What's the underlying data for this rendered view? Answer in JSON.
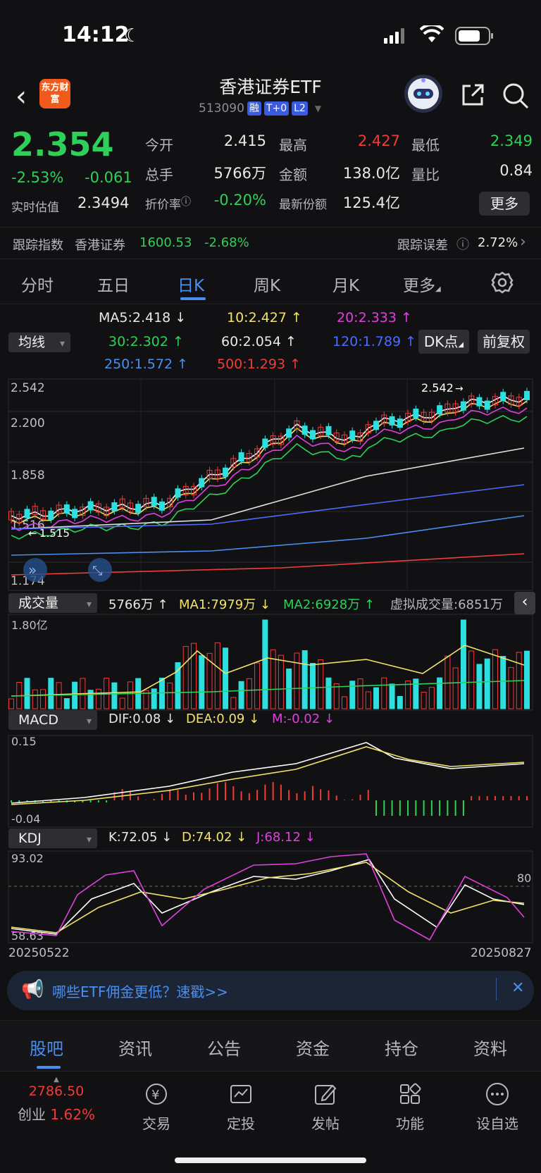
{
  "status": {
    "time": "14:12"
  },
  "header": {
    "back_icon": "chevron-left-icon",
    "logo_text": "东方财富",
    "title": "香港证券ETF",
    "code": "513090",
    "tags": [
      "融",
      "T+0",
      "L2"
    ]
  },
  "quote": {
    "price": "2.354",
    "pct": "-2.53%",
    "change": "-0.061",
    "est_label": "实时估值",
    "est_value": "2.3494",
    "open_label": "今开",
    "open": "2.415",
    "high_label": "最高",
    "high": "2.427",
    "low_label": "最低",
    "low": "2.349",
    "vol_label": "总手",
    "vol": "5766万",
    "amt_label": "金额",
    "amt": "138.0亿",
    "ratio_label": "量比",
    "ratio": "0.84",
    "discount_label": "折价率",
    "discount": "-0.20%",
    "shares_label": "最新份额",
    "shares": "125.4亿",
    "more": "更多"
  },
  "tracking": {
    "label": "跟踪指数",
    "index_name": "香港证券",
    "index_value": "1600.53",
    "index_pct": "-2.68%",
    "error_label": "跟踪误差",
    "error_value": "2.72%"
  },
  "tabs": [
    "分时",
    "五日",
    "日K",
    "周K",
    "月K",
    "更多"
  ],
  "active_tab": "日K",
  "ma": {
    "selector": "均线",
    "ma5": "MA5:2.418 ↓",
    "ma10": "10:2.427 ↑",
    "ma20": "20:2.333 ↑",
    "ma30": "30:2.302 ↑",
    "ma60": "60:2.054 ↑",
    "ma120": "120:1.789 ↑",
    "ma250": "250:1.572 ↑",
    "ma500": "500:1.293 ↑",
    "dk": "DK点",
    "fq": "前复权"
  },
  "kline": {
    "y_labels": [
      "2.542",
      "2.200",
      "1.858",
      "1.516",
      "1.174"
    ],
    "high_marker": "2.542",
    "low_marker": "1.515"
  },
  "volume": {
    "selector": "成交量",
    "vol": "5766万 ↑",
    "ma1": "MA1:7979万 ↓",
    "ma2": "MA2:6928万 ↑",
    "virtual": "虚拟成交量:6851万",
    "y_label": "1.80亿"
  },
  "macd": {
    "selector": "MACD",
    "dif": "DIF:0.08 ↓",
    "dea": "DEA:0.09 ↓",
    "m": "M:-0.02 ↓",
    "y_top": "0.15",
    "y_bottom": "-0.04"
  },
  "kdj": {
    "selector": "KDJ",
    "k": "K:72.05 ↓",
    "d": "D:74.02 ↓",
    "j": "J:68.12 ↓",
    "y_top": "93.02",
    "y_bottom": "58.63",
    "level": "80",
    "date_start": "20250522",
    "date_end": "20250827"
  },
  "promo": {
    "text": "哪些ETF佣金更低？速戳>>"
  },
  "bottom_tabs": [
    "股吧",
    "资讯",
    "公告",
    "资金",
    "持仓",
    "资料"
  ],
  "active_bottom_tab": "股吧",
  "index_widget": {
    "value": "2786.50",
    "name": "创业",
    "pct": "1.62%"
  },
  "tools": [
    "交易",
    "定投",
    "发帖",
    "功能",
    "设自选"
  ]
}
